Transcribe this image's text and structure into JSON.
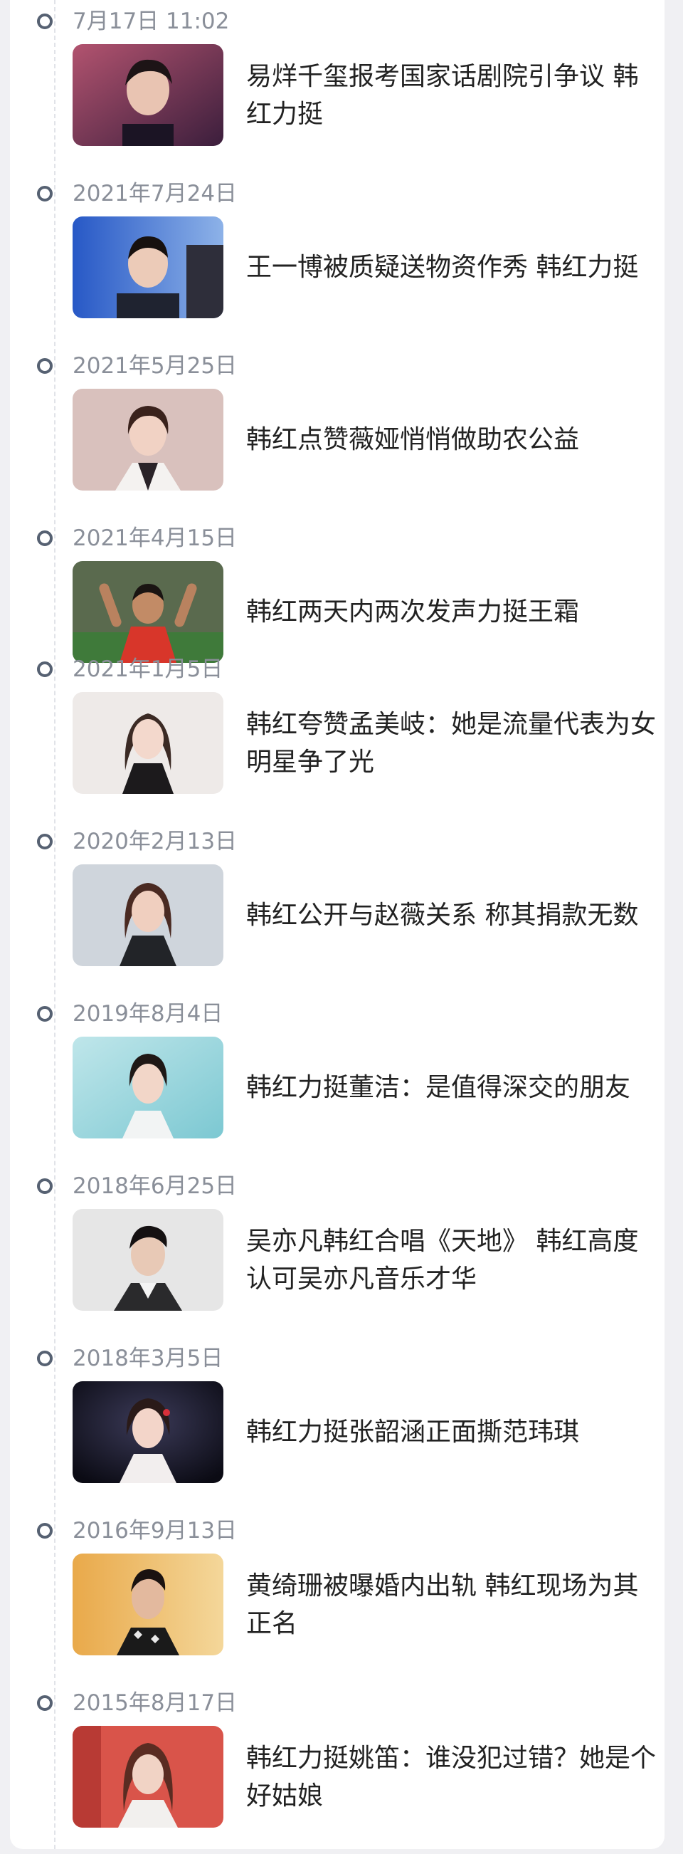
{
  "colors": {
    "background": "#f0f0f3",
    "card": "#ffffff",
    "date_text": "#8a8f99",
    "title_text": "#222222",
    "timeline_dot": "#566172",
    "timeline_line": "#e1e3e8"
  },
  "timeline": {
    "entries": [
      {
        "date": "7月17日 11:02",
        "title": "易烊千玺报考国家话剧院引争议 韩红力挺"
      },
      {
        "date": "2021年7月24日",
        "title": "王一博被质疑送物资作秀 韩红力挺"
      },
      {
        "date": "2021年5月25日",
        "title": "韩红点赞薇娅悄悄做助农公益"
      },
      {
        "date": "2021年4月15日",
        "title": "韩红两天内两次发声力挺王霜"
      },
      {
        "date": "2021年1月5日",
        "title": "韩红夸赞孟美岐：她是流量代表为女明星争了光"
      },
      {
        "date": "2020年2月13日",
        "title": "韩红公开与赵薇关系 称其捐款无数"
      },
      {
        "date": "2019年8月4日",
        "title": "韩红力挺董洁：是值得深交的朋友"
      },
      {
        "date": "2018年6月25日",
        "title": "吴亦凡韩红合唱《天地》 韩红高度认可吴亦凡音乐才华"
      },
      {
        "date": "2018年3月5日",
        "title": "韩红力挺张韶涵正面撕范玮琪"
      },
      {
        "date": "2016年9月13日",
        "title": "黄绮珊被曝婚内出轨 韩红现场为其正名"
      },
      {
        "date": "2015年8月17日",
        "title": "韩红力挺姚笛：谁没犯过错？她是个好姑娘"
      }
    ]
  }
}
